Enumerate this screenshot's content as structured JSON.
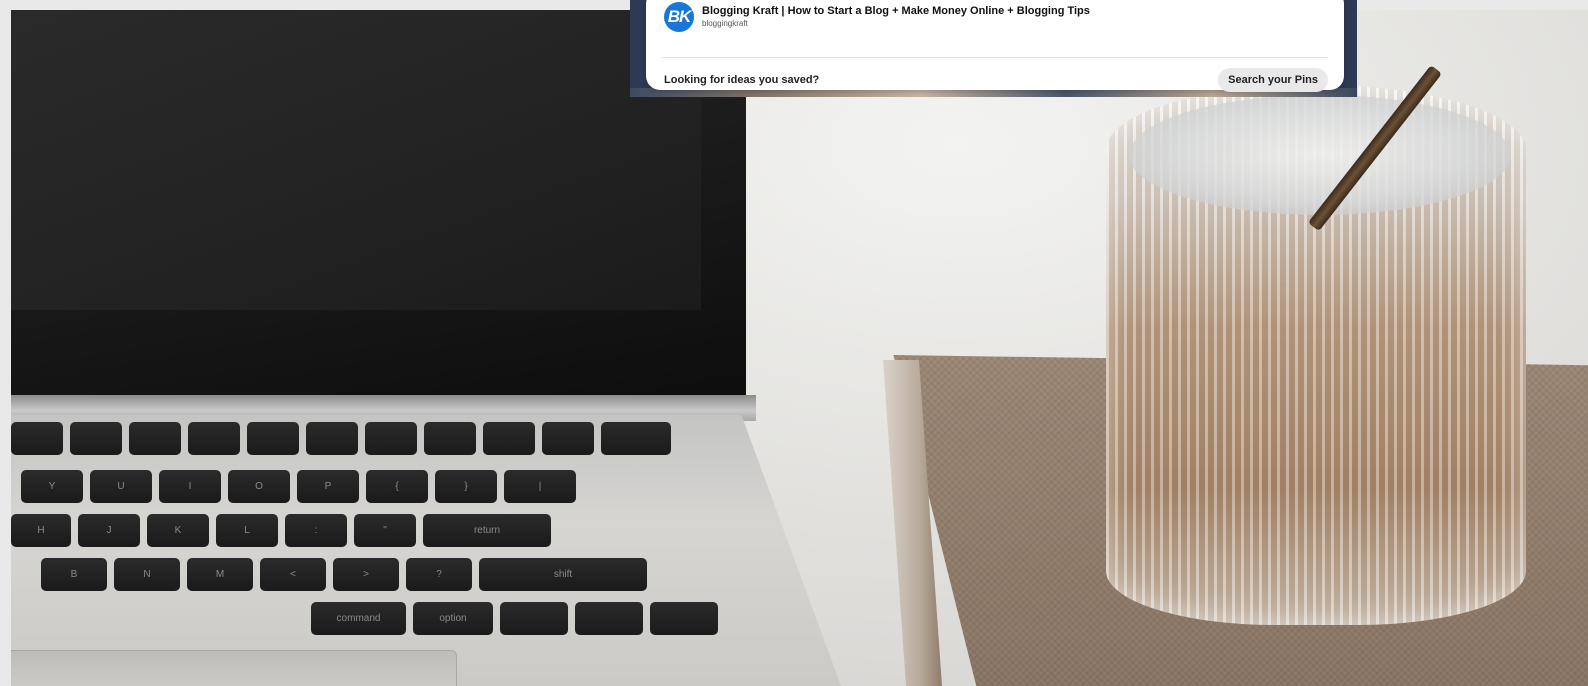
{
  "overlay": {
    "result": {
      "avatar_initials": "BK",
      "avatar_color": "#1877d6",
      "title": "Blogging Kraft | How to Start a Blog + Make Money Online + Blogging Tips",
      "handle": "bloggingkraft"
    },
    "footer": {
      "prompt": "Looking for ideas you saved?",
      "button_label": "Search your Pins"
    }
  },
  "keyboard": {
    "row1": [
      "",
      "",
      "",
      "",
      "",
      "",
      "",
      "",
      "",
      "",
      ""
    ],
    "row2": [
      "Y",
      "U",
      "I",
      "O",
      "P",
      "{",
      "}",
      "|"
    ],
    "row3": [
      "H",
      "J",
      "K",
      "L",
      ":",
      "\"",
      "return"
    ],
    "row4": [
      "B",
      "N",
      "M",
      "<",
      ">",
      "?",
      "shift"
    ],
    "row5": [
      "command",
      "option",
      "",
      "",
      ""
    ]
  }
}
